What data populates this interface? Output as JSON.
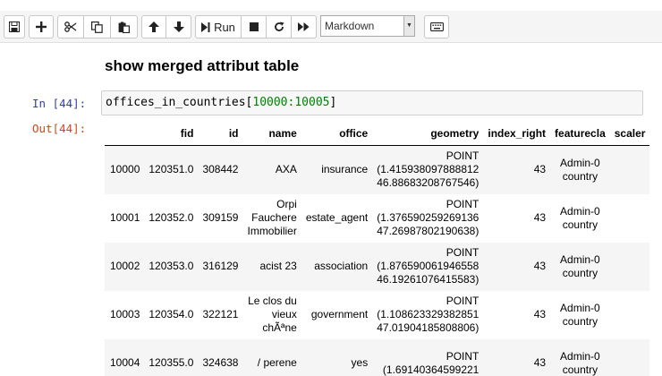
{
  "toolbar": {
    "run_label": "Run",
    "cell_type": "Markdown"
  },
  "notebook": {
    "heading": "show merged attribut table",
    "in_prompt": "In [44]:",
    "out_prompt": "Out[44]:",
    "code_name": "offices_in_countries[",
    "code_slice": "10000:10005",
    "code_end": "]"
  },
  "table": {
    "columns": [
      "",
      "fid",
      "id",
      "name",
      "office",
      "geometry",
      "index_right",
      "featurecla",
      "scaler"
    ],
    "rows": [
      {
        "index": "10000",
        "fid": "120351.0",
        "id": "308442",
        "name": [
          "AXA"
        ],
        "office": "insurance",
        "geometry": [
          "POINT",
          "(1.415938097888812",
          "46.88683208767546)"
        ],
        "index_right": "43",
        "featurecla": [
          "Admin-0",
          "country"
        ]
      },
      {
        "index": "10001",
        "fid": "120352.0",
        "id": "309159",
        "name": [
          "Orpi",
          "Fauchere",
          "Immobilier"
        ],
        "office": "estate_agent",
        "geometry": [
          "POINT",
          "(1.376590259269136",
          "47.26987802190638)"
        ],
        "index_right": "43",
        "featurecla": [
          "Admin-0",
          "country"
        ]
      },
      {
        "index": "10002",
        "fid": "120353.0",
        "id": "316129",
        "name": [
          "acist 23"
        ],
        "office": "association",
        "geometry": [
          "POINT",
          "(1.876590061946558",
          "46.19261076415583)"
        ],
        "index_right": "43",
        "featurecla": [
          "Admin-0",
          "country"
        ]
      },
      {
        "index": "10003",
        "fid": "120354.0",
        "id": "322121",
        "name": [
          "Le clos du",
          "vieux",
          "chÃªne"
        ],
        "office": "government",
        "geometry": [
          "POINT",
          "(1.108623329382851",
          "47.01904185808806)"
        ],
        "index_right": "43",
        "featurecla": [
          "Admin-0",
          "country"
        ]
      },
      {
        "index": "10004",
        "fid": "120355.0",
        "id": "324638",
        "name": [
          "/ perene"
        ],
        "office": "yes",
        "geometry": [
          "POINT",
          "(1.69140364599221",
          ""
        ],
        "index_right": "43",
        "featurecla": [
          "Admin-0",
          "country"
        ]
      }
    ]
  }
}
